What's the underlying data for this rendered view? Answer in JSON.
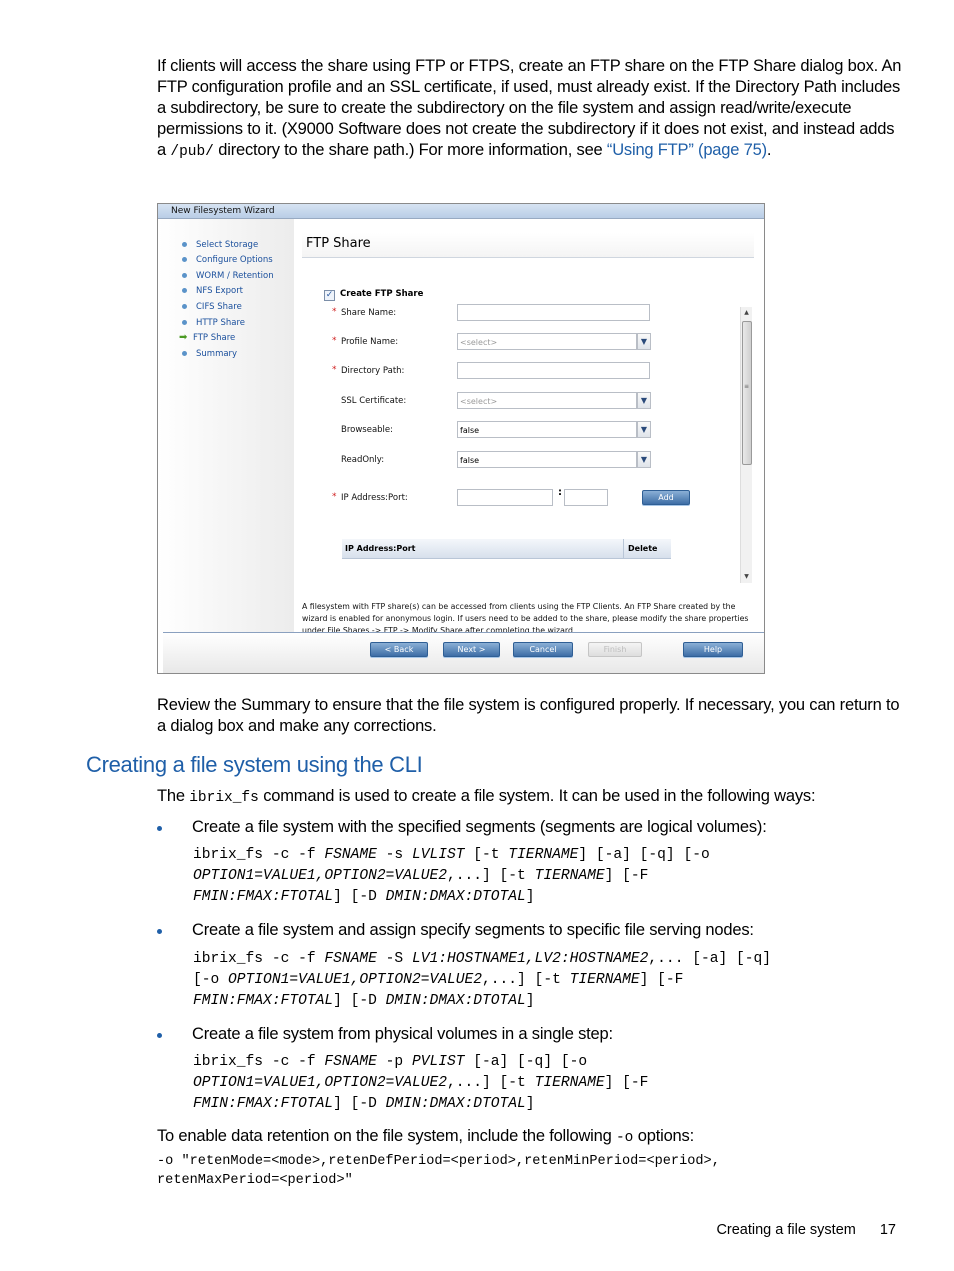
{
  "intro": {
    "text_before_code": "If clients will access the share using FTP or FTPS, create an FTP share on the FTP Share dialog box. An FTP configuration profile and an SSL certificate, if used, must already exist. If the Directory Path includes a subdirectory, be sure to create the subdirectory on the file system and assign read/write/execute permissions to it. (X9000 Software does not create the subdirectory if it does not exist, and instead adds a ",
    "code": "/pub/",
    "text_after_code": " directory to the share path.) For more information, see ",
    "link": "“Using FTP” (page 75)",
    "end": "."
  },
  "wizard": {
    "title": "New Filesystem Wizard",
    "steps": [
      {
        "label": "Select Storage",
        "current": false
      },
      {
        "label": "Configure Options",
        "current": false
      },
      {
        "label": "WORM / Retention",
        "current": false
      },
      {
        "label": "NFS Export",
        "current": false
      },
      {
        "label": "CIFS Share",
        "current": false
      },
      {
        "label": "HTTP Share",
        "current": false
      },
      {
        "label": "FTP Share",
        "current": true
      },
      {
        "label": "Summary",
        "current": false
      }
    ],
    "heading": "FTP Share",
    "create_checkbox": {
      "label": "Create FTP Share",
      "checked": true
    },
    "fields": {
      "share_name": {
        "label": "Share Name:",
        "required": true,
        "value": ""
      },
      "profile_name": {
        "label": "Profile Name:",
        "required": true,
        "value": "<select>"
      },
      "directory_path": {
        "label": "Directory Path:",
        "required": true,
        "value": ""
      },
      "ssl_certificate": {
        "label": "SSL Certificate:",
        "required": false,
        "value": "<select>"
      },
      "browseable": {
        "label": "Browseable:",
        "required": false,
        "value": "false"
      },
      "readonly": {
        "label": "ReadOnly:",
        "required": false,
        "value": "false"
      },
      "ip_port": {
        "label": "IP Address:Port:",
        "required": true,
        "ip_value": "",
        "port_value": "",
        "separator": ":"
      }
    },
    "required_mark": "*",
    "add_button": "Add",
    "table": {
      "columns": [
        "IP Address:Port",
        "Delete"
      ],
      "rows": []
    },
    "note": "A filesystem with FTP share(s) can be accessed from clients using the FTP Clients. An FTP Share created by the wizard is enabled for anonymous login. If users need to be added to the share, please modify the share properties under File Shares -> FTP -> Modify Share after completing the wizard.",
    "buttons": {
      "back": "< Back",
      "next": "Next >",
      "cancel": "Cancel",
      "finish": "Finish",
      "help": "Help"
    }
  },
  "review_text": "Review the Summary to ensure that the file system is configured properly. If necessary, you can return to a dialog box and make any corrections.",
  "section_heading": "Creating a file system using the CLI",
  "cli_intro": {
    "before": "The ",
    "code": "ibrix_fs",
    "after": " command is used to create a file system. It can be used in the following ways:"
  },
  "bullets": [
    {
      "text": "Create a file system with the specified segments (segments are logical volumes):"
    },
    {
      "text": "Create a file system and assign specify segments to specific file serving nodes:"
    },
    {
      "text": "Create a file system from physical volumes in a single step:"
    }
  ],
  "retention": {
    "before": "To enable data retention on the file system, include the following ",
    "code": "-o",
    "after": " options:",
    "command_line1": "-o \"retenMode=<mode>,retenDefPeriod=<period>,retenMinPeriod=<period>,",
    "command_line2": "retenMaxPeriod=<period>\""
  },
  "footer": {
    "section": "Creating a file system",
    "page": "17"
  }
}
